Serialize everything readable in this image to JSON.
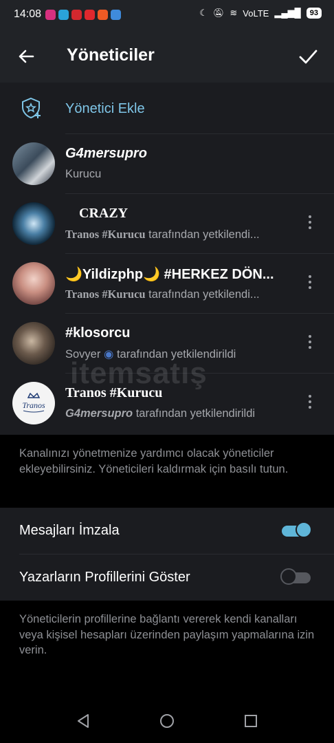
{
  "status_bar": {
    "time": "14:08",
    "network": "VoLTE",
    "battery": "93"
  },
  "header": {
    "title": "Yöneticiler"
  },
  "add_admin": {
    "label": "Yönetici Ekle"
  },
  "admins": [
    {
      "name": "G4mersupro",
      "subtitle": "Kurucu",
      "prefix": "",
      "suffix": ""
    },
    {
      "name": "CRAZY",
      "prefix": "Tranos #Kurucu",
      "suffix": " tarafından yetkilendi..."
    },
    {
      "name": "🌙Yildizphp🌙 #HERKEZ DÖN...",
      "prefix": "Tranos #Kurucu",
      "suffix": " tarafından yetkilendi..."
    },
    {
      "name": "#klosorcu",
      "prefix": "Sovyer",
      "suffix": " tarafından yetkilendirildi"
    },
    {
      "name": "Tranos #Kurucu",
      "prefix": "G4mersupro",
      "suffix": " tarafından yetkilendirildi"
    }
  ],
  "admins_hint": "Kanalınızı yönetmenize yardımcı olacak yöneticiler ekleyebilirsiniz. Yöneticileri kaldırmak için basılı tutun.",
  "settings": {
    "sign_messages": {
      "label": "Mesajları İmzala",
      "enabled": true
    },
    "show_profiles": {
      "label": "Yazarların Profillerini Göster",
      "enabled": false
    }
  },
  "settings_hint": "Yöneticilerin profillerine bağlantı vererek kendi kanalları veya kişisel hesapları üzerinden paylaşım yapmalarına izin verin.",
  "watermark": "itemsatış",
  "colors": {
    "accent": "#7fc6e8",
    "toggle_on": "#5fb5d8",
    "background": "#1b1c20"
  }
}
